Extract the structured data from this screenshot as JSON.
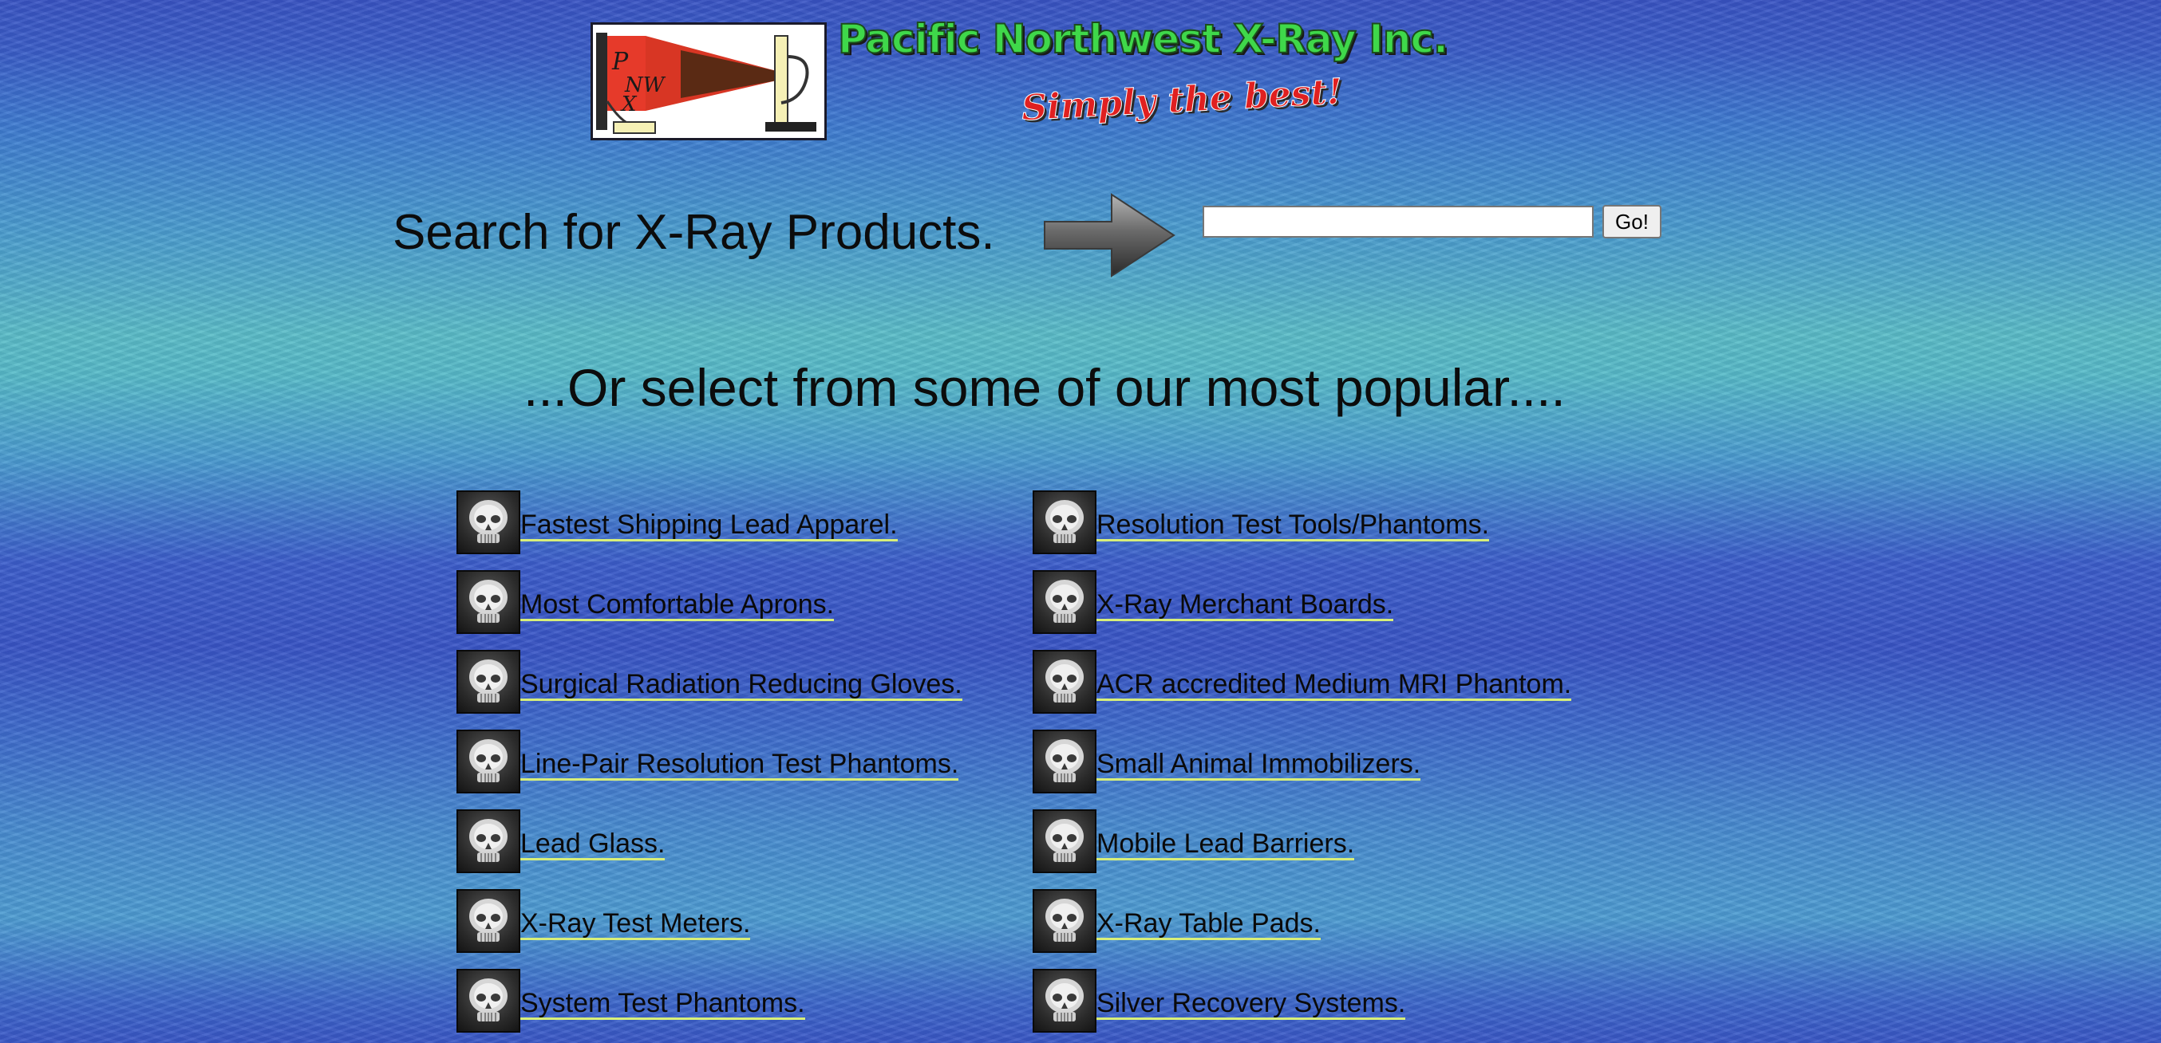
{
  "header": {
    "title": "Pacific Northwest X-Ray Inc.",
    "tagline": "Simply the best!",
    "logo_icon": "pnwx-xray-logo",
    "logo_text": "PNWX"
  },
  "search": {
    "heading": "Search for X-Ray Products.",
    "arrow_icon": "arrow-right-icon",
    "input_value": "",
    "button_label": "Go!"
  },
  "popular": {
    "heading": "...Or select from some of our most popular....",
    "item_icon": "skull-xray-icon",
    "left": [
      "Fastest Shipping Lead Apparel.",
      "Most Comfortable Aprons.",
      "Surgical Radiation Reducing Gloves.",
      "Line-Pair Resolution Test Phantoms.",
      "Lead Glass.",
      "X-Ray Test Meters.",
      "System Test Phantoms."
    ],
    "right": [
      "Resolution Test Tools/Phantoms.",
      "X-Ray Merchant Boards.",
      "ACR accredited Medium MRI Phantom.",
      "Small Animal Immobilizers.",
      "Mobile Lead Barriers.",
      "X-Ray Table Pads.",
      "Silver Recovery Systems."
    ]
  },
  "colors": {
    "title_green": "#3fd84a",
    "tagline_red": "#e02020",
    "link_underline": "#d8ef7a",
    "background_blue": "#3a56c6",
    "background_teal": "#5cbec8"
  }
}
